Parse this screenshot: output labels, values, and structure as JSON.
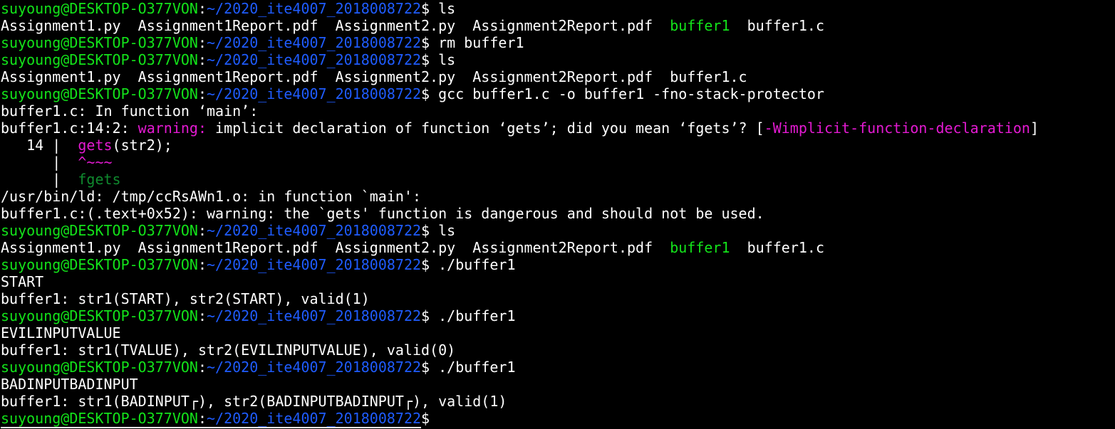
{
  "prompt": {
    "user_host": "suyoung@DESKTOP-O377VON",
    "colon": ":",
    "path": "~/2020_ite4007_2018008722",
    "dollar": "$"
  },
  "colors": {
    "background": "#000000",
    "text": "#ffffff",
    "user_host": "#13e31a",
    "path": "#1f5cff",
    "executable": "#13e31a",
    "warning": "#e31ad1",
    "fix_hint": "#0f8a2e"
  },
  "lines": [
    {
      "type": "prompt",
      "cmd": " ls"
    },
    {
      "type": "ls",
      "items": [
        {
          "text": "Assignment1.py  ",
          "cls": "plain"
        },
        {
          "text": "Assignment1Report.pdf  ",
          "cls": "plain"
        },
        {
          "text": "Assignment2.py  ",
          "cls": "plain"
        },
        {
          "text": "Assignment2Report.pdf  ",
          "cls": "plain"
        },
        {
          "text": "buffer1",
          "cls": "exe"
        },
        {
          "text": "  ",
          "cls": "plain"
        },
        {
          "text": "buffer1.c",
          "cls": "plain"
        }
      ]
    },
    {
      "type": "prompt",
      "cmd": " rm buffer1"
    },
    {
      "type": "prompt",
      "cmd": " ls"
    },
    {
      "type": "ls",
      "items": [
        {
          "text": "Assignment1.py  ",
          "cls": "plain"
        },
        {
          "text": "Assignment1Report.pdf  ",
          "cls": "plain"
        },
        {
          "text": "Assignment2.py  ",
          "cls": "plain"
        },
        {
          "text": "Assignment2Report.pdf  ",
          "cls": "plain"
        },
        {
          "text": "buffer1.c",
          "cls": "plain"
        }
      ]
    },
    {
      "type": "prompt",
      "cmd": " gcc buffer1.c -o buffer1 -fno-stack-protector"
    },
    {
      "type": "out",
      "items": [
        {
          "text": "buffer1.c: In function ‘main’:",
          "cls": "plain"
        }
      ]
    },
    {
      "type": "out",
      "items": [
        {
          "text": "buffer1.c:14:2: ",
          "cls": "plain"
        },
        {
          "text": "warning:",
          "cls": "warn"
        },
        {
          "text": " implicit declaration of function ‘gets’; did you mean ‘fgets’? [",
          "cls": "plain"
        },
        {
          "text": "-Wimplicit-function-declaration",
          "cls": "warn"
        },
        {
          "text": "]",
          "cls": "plain"
        }
      ]
    },
    {
      "type": "out",
      "items": [
        {
          "text": "   14 |  ",
          "cls": "plain"
        },
        {
          "text": "gets",
          "cls": "warn"
        },
        {
          "text": "(str2);",
          "cls": "plain"
        }
      ]
    },
    {
      "type": "out",
      "items": [
        {
          "text": "      |  ",
          "cls": "plain"
        },
        {
          "text": "^~~~",
          "cls": "warn"
        }
      ]
    },
    {
      "type": "out",
      "items": [
        {
          "text": "      |  ",
          "cls": "plain"
        },
        {
          "text": "fgets",
          "cls": "fix"
        }
      ]
    },
    {
      "type": "out",
      "items": [
        {
          "text": "/usr/bin/ld: /tmp/ccRsAWn1.o: in function `main':",
          "cls": "plain"
        }
      ]
    },
    {
      "type": "out",
      "items": [
        {
          "text": "buffer1.c:(.text+0x52): warning: the `gets' function is dangerous and should not be used.",
          "cls": "plain"
        }
      ]
    },
    {
      "type": "prompt",
      "cmd": " ls"
    },
    {
      "type": "ls",
      "items": [
        {
          "text": "Assignment1.py  ",
          "cls": "plain"
        },
        {
          "text": "Assignment1Report.pdf  ",
          "cls": "plain"
        },
        {
          "text": "Assignment2.py  ",
          "cls": "plain"
        },
        {
          "text": "Assignment2Report.pdf  ",
          "cls": "plain"
        },
        {
          "text": "buffer1",
          "cls": "exe"
        },
        {
          "text": "  ",
          "cls": "plain"
        },
        {
          "text": "buffer1.c",
          "cls": "plain"
        }
      ]
    },
    {
      "type": "prompt",
      "cmd": " ./buffer1"
    },
    {
      "type": "out",
      "items": [
        {
          "text": "START",
          "cls": "plain"
        }
      ]
    },
    {
      "type": "out",
      "items": [
        {
          "text": "buffer1: str1(START), str2(START), valid(1)",
          "cls": "plain"
        }
      ]
    },
    {
      "type": "prompt",
      "cmd": " ./buffer1"
    },
    {
      "type": "out",
      "items": [
        {
          "text": "EVILINPUTVALUE",
          "cls": "plain"
        }
      ]
    },
    {
      "type": "out",
      "items": [
        {
          "text": "buffer1: str1(TVALUE), str2(EVILINPUTVALUE), valid(0)",
          "cls": "plain"
        }
      ]
    },
    {
      "type": "prompt",
      "cmd": " ./buffer1"
    },
    {
      "type": "out",
      "items": [
        {
          "text": "BADINPUTBADINPUT",
          "cls": "plain"
        }
      ]
    },
    {
      "type": "out",
      "items": [
        {
          "text": "buffer1: str1(BADINPUT┌), str2(BADINPUTBADINPUT┌), valid(1)",
          "cls": "plain"
        }
      ]
    },
    {
      "type": "prompt",
      "cmd": "",
      "last": true
    }
  ]
}
